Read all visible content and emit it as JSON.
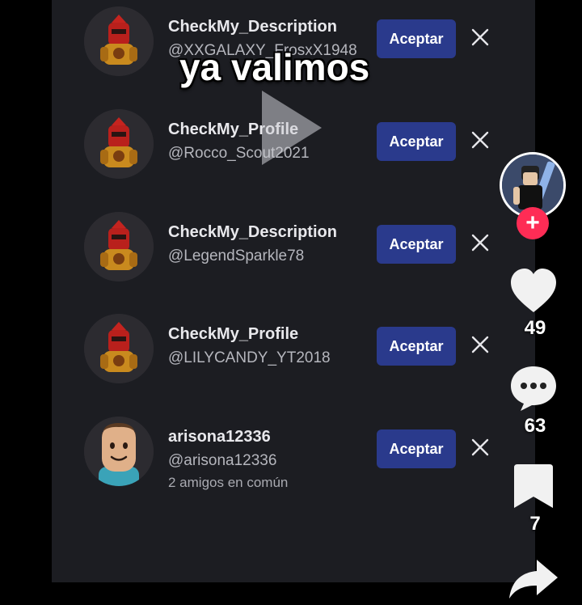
{
  "overlay": {
    "caption": "ya valimos"
  },
  "requests": [
    {
      "name": "CheckMy_Description",
      "handle": "@XXGALAXY_FrosxX1948",
      "accept_label": "Aceptar",
      "avatar": "armored-knight-avatar"
    },
    {
      "name": "CheckMy_Profile",
      "handle": "@Rocco_Scout2021",
      "accept_label": "Aceptar",
      "avatar": "armored-knight-avatar"
    },
    {
      "name": "CheckMy_Description",
      "handle": "@LegendSparkle78",
      "accept_label": "Aceptar",
      "avatar": "armored-knight-avatar"
    },
    {
      "name": "CheckMy_Profile",
      "handle": "@LILYCANDY_YT2018",
      "accept_label": "Aceptar",
      "avatar": "armored-knight-avatar"
    },
    {
      "name": "arisona12336",
      "handle": "@arisona12336",
      "mutual": "2 amigos en común",
      "accept_label": "Aceptar",
      "avatar": "smiling-face-avatar"
    }
  ],
  "rail": {
    "likes": "49",
    "comments": "63",
    "saves": "7",
    "icons": [
      "creator-avatar",
      "follow-plus-icon",
      "heart-icon",
      "comment-icon",
      "bookmark-icon",
      "share-icon"
    ]
  },
  "colors": {
    "accept_button": "#2a3a8c",
    "follow_button": "#fe2c55",
    "panel": "#1c1d22"
  }
}
